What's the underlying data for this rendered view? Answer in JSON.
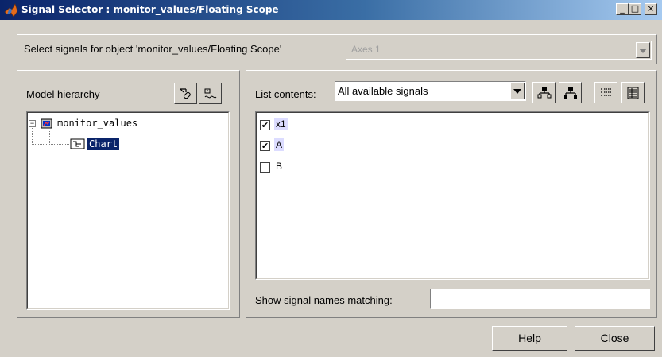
{
  "window": {
    "title": "Signal Selector : monitor_values/Floating Scope",
    "minimize_glyph": "_",
    "maximize_glyph": "□",
    "close_glyph": "×"
  },
  "header": {
    "prompt": "Select signals for object 'monitor_values/Floating Scope'",
    "axes_value": "Axes 1"
  },
  "left_panel": {
    "title": "Model hierarchy",
    "tree": {
      "root_label": "monitor_values",
      "child_label": "Chart",
      "root_expander": "−"
    }
  },
  "right_panel": {
    "list_contents_label": "List contents:",
    "list_contents_value": "All available signals",
    "signals": [
      {
        "name": "x1",
        "checked": true
      },
      {
        "name": "A",
        "checked": true
      },
      {
        "name": "B",
        "checked": false
      }
    ],
    "filter_label": "Show signal names matching:",
    "filter_value": ""
  },
  "buttons": {
    "help": "Help",
    "close": "Close"
  },
  "colors": {
    "title_gradient_start": "#0a246a",
    "title_gradient_end": "#a6caf0",
    "selection": "#0a246a",
    "signal_highlight": "#dcdcff",
    "background": "#d4d0c8"
  }
}
